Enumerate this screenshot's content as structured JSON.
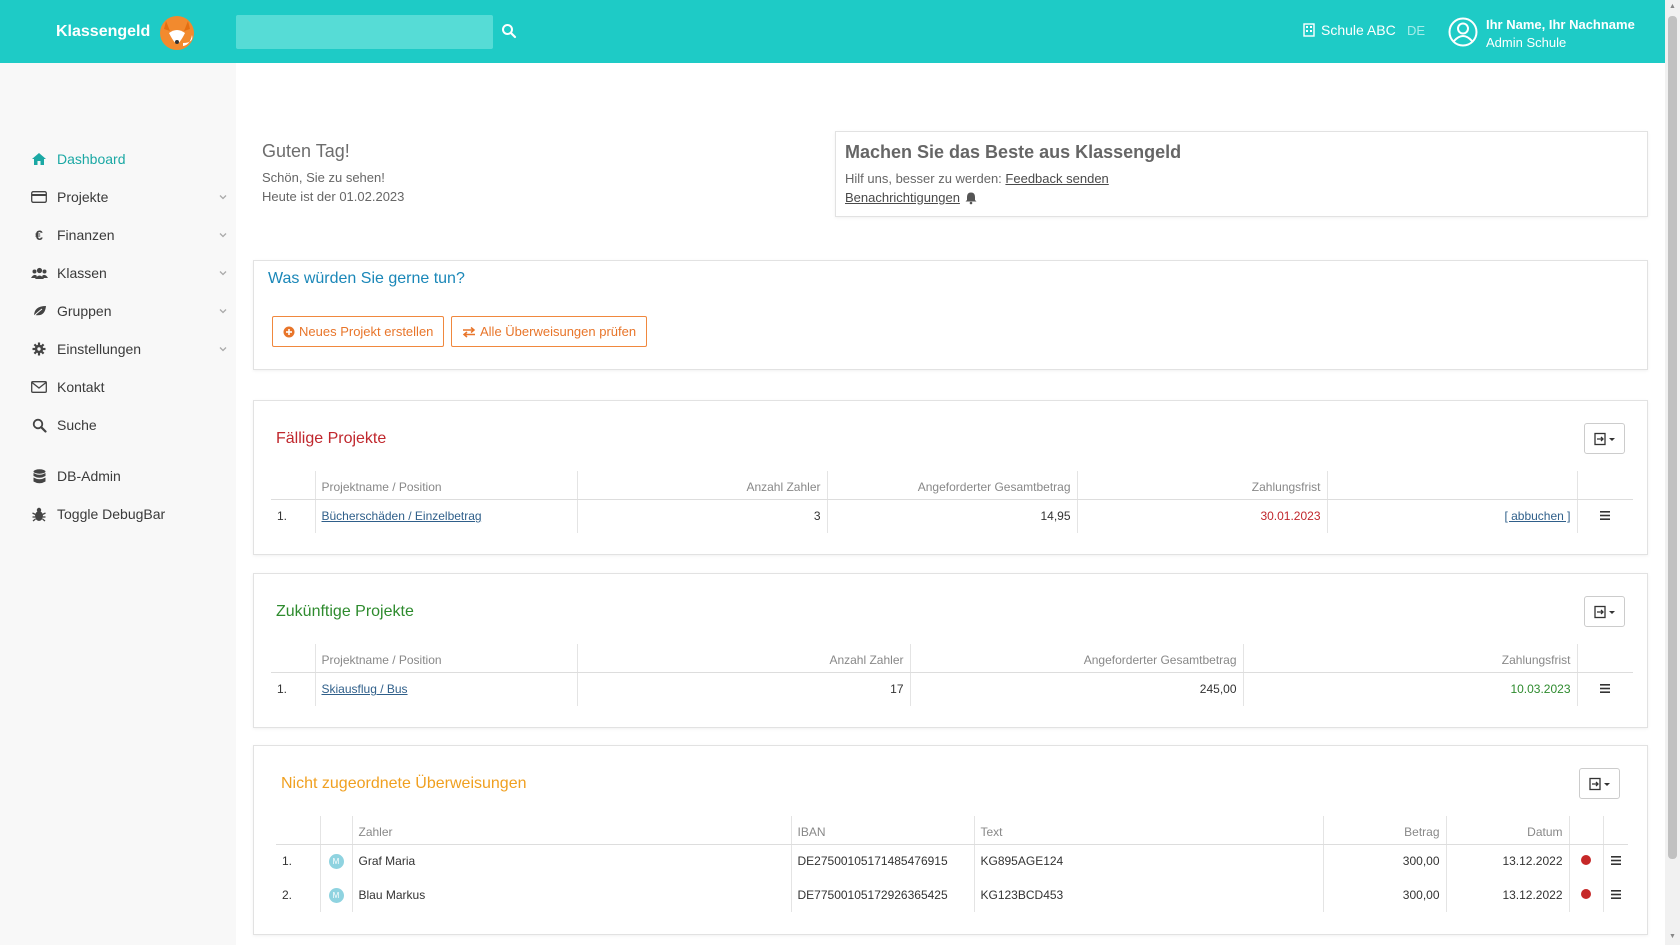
{
  "header": {
    "brand": "Klassengeld",
    "search_placeholder": "",
    "school": "Schule ABC",
    "language": "DE",
    "user_name": "Ihr Name, Ihr Nachname",
    "user_role": "Admin Schule"
  },
  "sidebar": {
    "items": [
      {
        "label": "Dashboard",
        "icon": "home-icon"
      },
      {
        "label": "Projekte",
        "icon": "credit-card-icon"
      },
      {
        "label": "Finanzen",
        "icon": "euro-icon"
      },
      {
        "label": "Klassen",
        "icon": "users-icon"
      },
      {
        "label": "Gruppen",
        "icon": "leaf-icon"
      },
      {
        "label": "Einstellungen",
        "icon": "gear-icon"
      },
      {
        "label": "Kontakt",
        "icon": "envelope-icon"
      },
      {
        "label": "Suche",
        "icon": "search-icon"
      },
      {
        "label": "DB-Admin",
        "icon": "database-icon"
      },
      {
        "label": "Toggle DebugBar",
        "icon": "bug-icon"
      }
    ]
  },
  "greeting": {
    "title": "Guten Tag!",
    "line1": "Schön, Sie zu sehen!",
    "line2": "Heute ist der 01.02.2023"
  },
  "promo": {
    "title": "Machen Sie das Beste aus Klassengeld",
    "text": "Hilf uns, besser zu werden:",
    "feedback_link": "Feedback senden",
    "notifications_link": "Benachrichtigungen"
  },
  "actions": {
    "title": "Was würden Sie gerne tun?",
    "new_project": "Neues Projekt erstellen",
    "check_transfers": "Alle Überweisungen prüfen"
  },
  "due_projects": {
    "title": "Fällige Projekte",
    "columns": [
      "Projektname / Position",
      "Anzahl Zahler",
      "Angeforderter Gesamtbetrag",
      "Zahlungsfrist"
    ],
    "rows": [
      {
        "num": "1.",
        "name": "Bücherschäden / Einzelbetrag",
        "payers": "3",
        "amount": "14,95",
        "deadline": "30.01.2023",
        "action": "[ abbuchen ]"
      }
    ]
  },
  "future_projects": {
    "title": "Zukünftige Projekte",
    "columns": [
      "Projektname / Position",
      "Anzahl Zahler",
      "Angeforderter Gesamtbetrag",
      "Zahlungsfrist"
    ],
    "rows": [
      {
        "num": "1.",
        "name": "Skiausflug / Bus",
        "payers": "17",
        "amount": "245,00",
        "deadline": "10.03.2023"
      }
    ]
  },
  "unassigned": {
    "title": "Nicht zugeordnete Überweisungen",
    "columns": [
      "Zahler",
      "IBAN",
      "Text",
      "Betrag",
      "Datum"
    ],
    "rows": [
      {
        "num": "1.",
        "avatar": "M",
        "payer": "Graf Maria",
        "iban": "DE27500105171485476915",
        "text": "KG895AGE124",
        "amount": "300,00",
        "date": "13.12.2022"
      },
      {
        "num": "2.",
        "avatar": "M",
        "payer": "Blau Markus",
        "iban": "DE77500105172926365425",
        "text": "KG123BCD453",
        "amount": "300,00",
        "date": "13.12.2022"
      }
    ]
  },
  "colors": {
    "header": "#1ecbc6",
    "accent_orange": "#e8752a",
    "due_title": "#c0272d",
    "future_title": "#2e8b2e",
    "unassigned_title": "#f0a020",
    "action_title": "#1a87b8"
  }
}
